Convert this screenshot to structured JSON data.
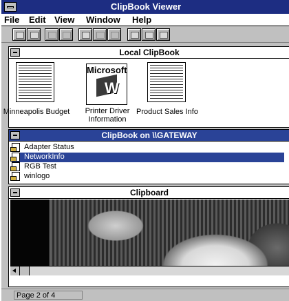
{
  "window": {
    "title": "ClipBook Viewer"
  },
  "menu": [
    {
      "label": "File"
    },
    {
      "label": "Edit"
    },
    {
      "label": "View"
    },
    {
      "label": "Window"
    },
    {
      "label": "Help"
    }
  ],
  "toolbar": {
    "buttons": [
      "connect-icon",
      "disconnect-icon",
      "share-icon",
      "stop-sharing-icon",
      "copy-icon",
      "paste-icon",
      "delete-icon",
      "table-of-contents-icon",
      "thumbnails-icon",
      "full-page-icon"
    ]
  },
  "local_clipbook": {
    "title": "Local ClipBook",
    "items": [
      {
        "label": "Minneapolis Budget",
        "icon": "spreadsheet-page-icon"
      },
      {
        "label": "Printer Driver Information",
        "icon": "microsoft-word-page-icon",
        "thumb_text": "Microsoft"
      },
      {
        "label": "Product Sales Info",
        "icon": "spreadsheet-page-icon"
      }
    ]
  },
  "remote_clipbook": {
    "title": "ClipBook on \\\\GATEWAY",
    "items": [
      {
        "label": "Adapter Status",
        "selected": false
      },
      {
        "label": "NetworkInfo",
        "selected": true
      },
      {
        "label": "RGB Test",
        "selected": false
      },
      {
        "label": "winlogo",
        "selected": false
      }
    ]
  },
  "clipboard": {
    "title": "Clipboard",
    "content": "photo-of-domed-buildings"
  },
  "status": {
    "page_text": "Page 2 of 4"
  },
  "colors": {
    "title_bar": "#1d2d82",
    "active_panel": "#2a4397",
    "selection": "#2a4397"
  }
}
